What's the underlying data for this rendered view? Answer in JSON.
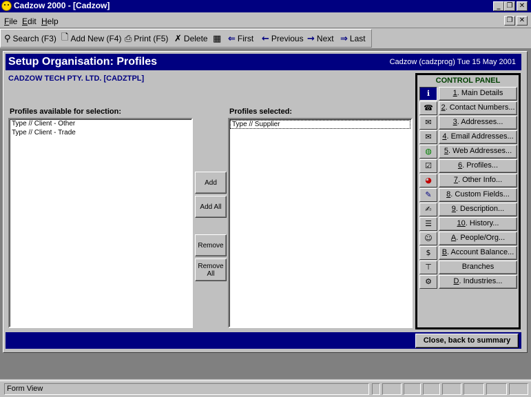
{
  "window": {
    "title": "Cadzow 2000 - [Cadzow]",
    "controls": {
      "minimize": "_",
      "restore": "❐",
      "close": "✕"
    }
  },
  "menu": {
    "items": [
      {
        "label": "File",
        "accel": "F",
        "rest": "ile"
      },
      {
        "label": "Edit",
        "accel": "E",
        "rest": "dit"
      },
      {
        "label": "Help",
        "accel": "H",
        "rest": "elp"
      }
    ]
  },
  "toolbar": {
    "search": "Search (F3)",
    "add_new": "Add New (F4)",
    "print": "Print (F5)",
    "delete": "Delete",
    "first": "First",
    "previous": "Previous",
    "next": "Next",
    "last": "Last"
  },
  "form": {
    "title": "Setup Organisation: Profiles",
    "session_info": "Cadzow (cadzprog) Tue 15 May 2001",
    "organisation": "CADZOW TECH PTY. LTD.  [CADZTPL]",
    "available_label": "Profiles available for selection:",
    "selected_label": "Profiles selected:",
    "available_items": [
      "Type // Client - Other",
      "Type // Client - Trade"
    ],
    "selected_items": [
      "Type // Supplier"
    ],
    "buttons": {
      "add": "Add",
      "add_all": "Add All",
      "remove": "Remove",
      "remove_all_1": "Remove",
      "remove_all_2": "All"
    },
    "close_button": "Close, back to summary"
  },
  "control_panel": {
    "title": "CONTROL PANEL",
    "items": [
      {
        "accel": "1",
        "label": ". Main Details",
        "icon": "info-icon"
      },
      {
        "accel": "2",
        "label": ". Contact Numbers...",
        "icon": "phone-icon"
      },
      {
        "accel": "3",
        "label": ". Addresses...",
        "icon": "envelope-icon"
      },
      {
        "accel": "4",
        "label": ". Email Addresses...",
        "icon": "email-icon"
      },
      {
        "accel": "5",
        "label": ". Web Addresses...",
        "icon": "globe-icon"
      },
      {
        "accel": "6",
        "label": ". Profiles...",
        "icon": "profile-icon"
      },
      {
        "accel": "7",
        "label": ". Other Info...",
        "icon": "chart-icon"
      },
      {
        "accel": "8",
        "label": ". Custom Fields...",
        "icon": "pen-icon"
      },
      {
        "accel": "9",
        "label": ". Description...",
        "icon": "note-icon"
      },
      {
        "accel": "10",
        "label": ". History...",
        "icon": "list-icon"
      },
      {
        "accel": "A",
        "label": ". People/Org...",
        "icon": "people-icon"
      },
      {
        "accel": "B",
        "label": ". Account Balance...",
        "icon": "dollar-icon"
      },
      {
        "accel": "",
        "label": "Branches",
        "icon": "tree-icon"
      },
      {
        "accel": "D",
        "label": ". Industries...",
        "icon": "gears-icon"
      }
    ]
  },
  "statusbar": {
    "text": "Form View"
  }
}
